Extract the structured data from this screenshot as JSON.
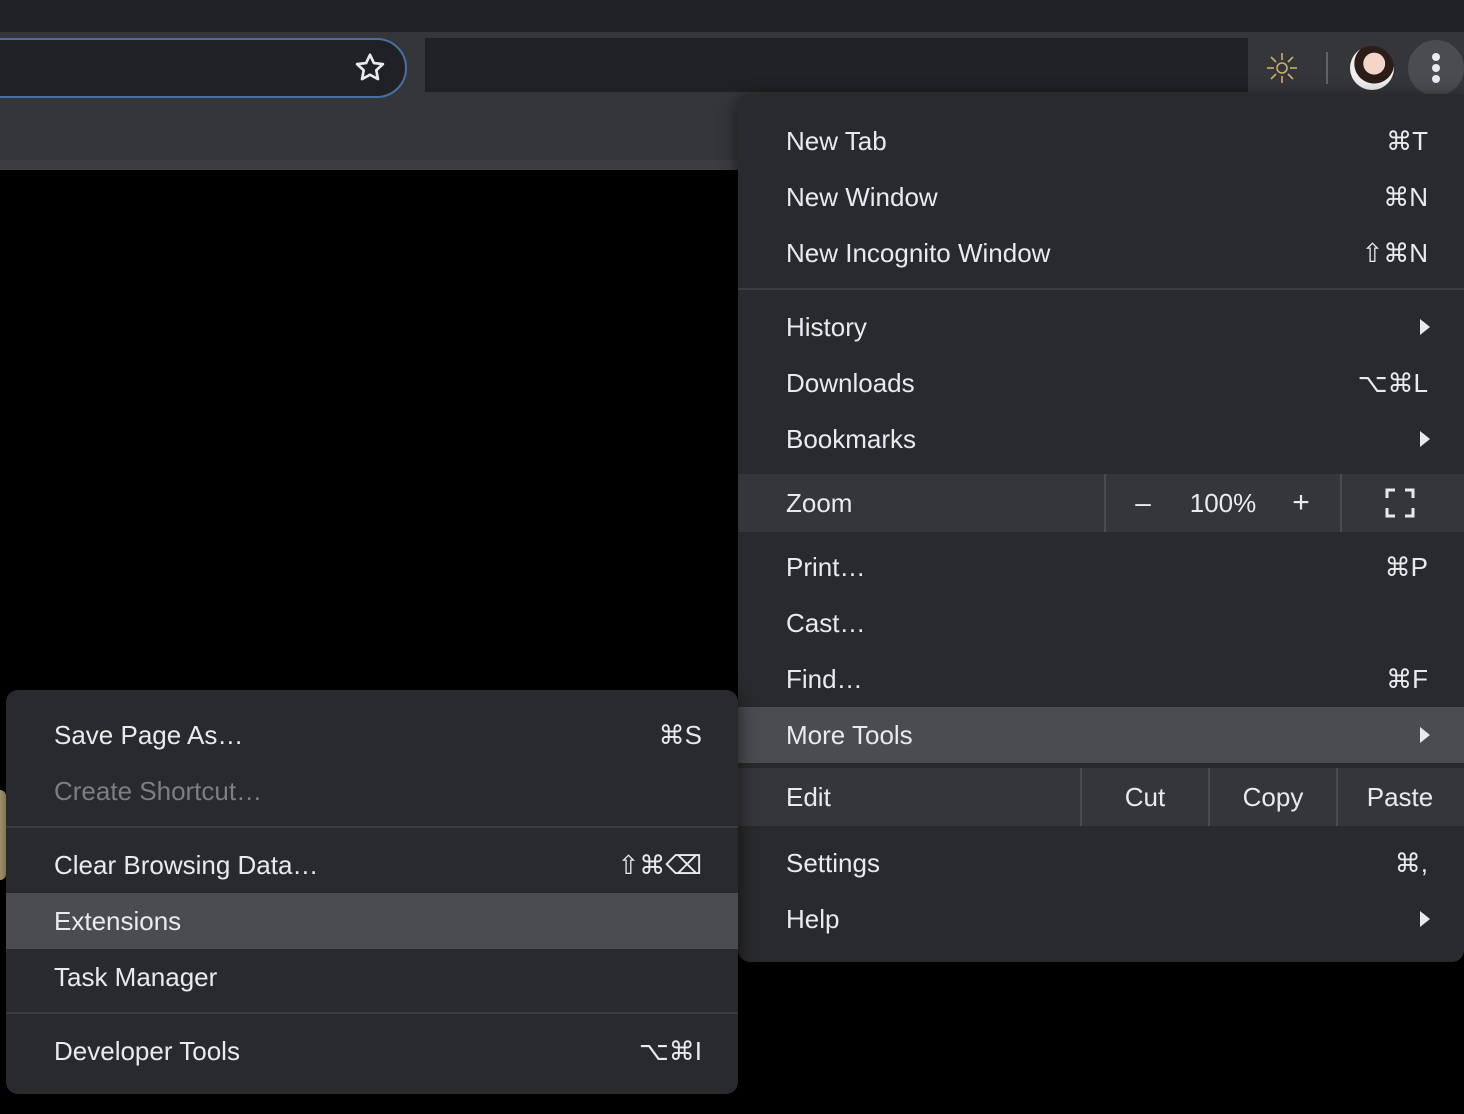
{
  "toolbar": {
    "bookmark_star": "star-icon",
    "extension_icon": "sun-icon",
    "profile_avatar": "avatar",
    "menu_button": "kebab-menu-icon"
  },
  "menu": {
    "new_tab": {
      "label": "New Tab",
      "shortcut": "⌘T"
    },
    "new_window": {
      "label": "New Window",
      "shortcut": "⌘N"
    },
    "new_incognito": {
      "label": "New Incognito Window",
      "shortcut": "⇧⌘N"
    },
    "history": {
      "label": "History"
    },
    "downloads": {
      "label": "Downloads",
      "shortcut": "⌥⌘L"
    },
    "bookmarks": {
      "label": "Bookmarks"
    },
    "zoom": {
      "label": "Zoom",
      "minus": "–",
      "value": "100%",
      "plus": "+"
    },
    "print": {
      "label": "Print…",
      "shortcut": "⌘P"
    },
    "cast": {
      "label": "Cast…"
    },
    "find": {
      "label": "Find…",
      "shortcut": "⌘F"
    },
    "more_tools": {
      "label": "More Tools"
    },
    "edit": {
      "label": "Edit",
      "cut": "Cut",
      "copy": "Copy",
      "paste": "Paste"
    },
    "settings": {
      "label": "Settings",
      "shortcut": "⌘,"
    },
    "help": {
      "label": "Help"
    }
  },
  "submenu": {
    "save_page": {
      "label": "Save Page As…",
      "shortcut": "⌘S"
    },
    "create_shortcut": {
      "label": "Create Shortcut…"
    },
    "clear_data": {
      "label": "Clear Browsing Data…",
      "shortcut": "⇧⌘⌫"
    },
    "extensions": {
      "label": "Extensions"
    },
    "task_manager": {
      "label": "Task Manager"
    },
    "dev_tools": {
      "label": "Developer Tools",
      "shortcut": "⌥⌘I"
    }
  },
  "colors": {
    "menu_bg": "#292a2d",
    "highlight": "#4a4c50",
    "text": "#e8eaed",
    "disabled_text": "#7b7e83",
    "omnibox_border": "#4a6fa0"
  }
}
